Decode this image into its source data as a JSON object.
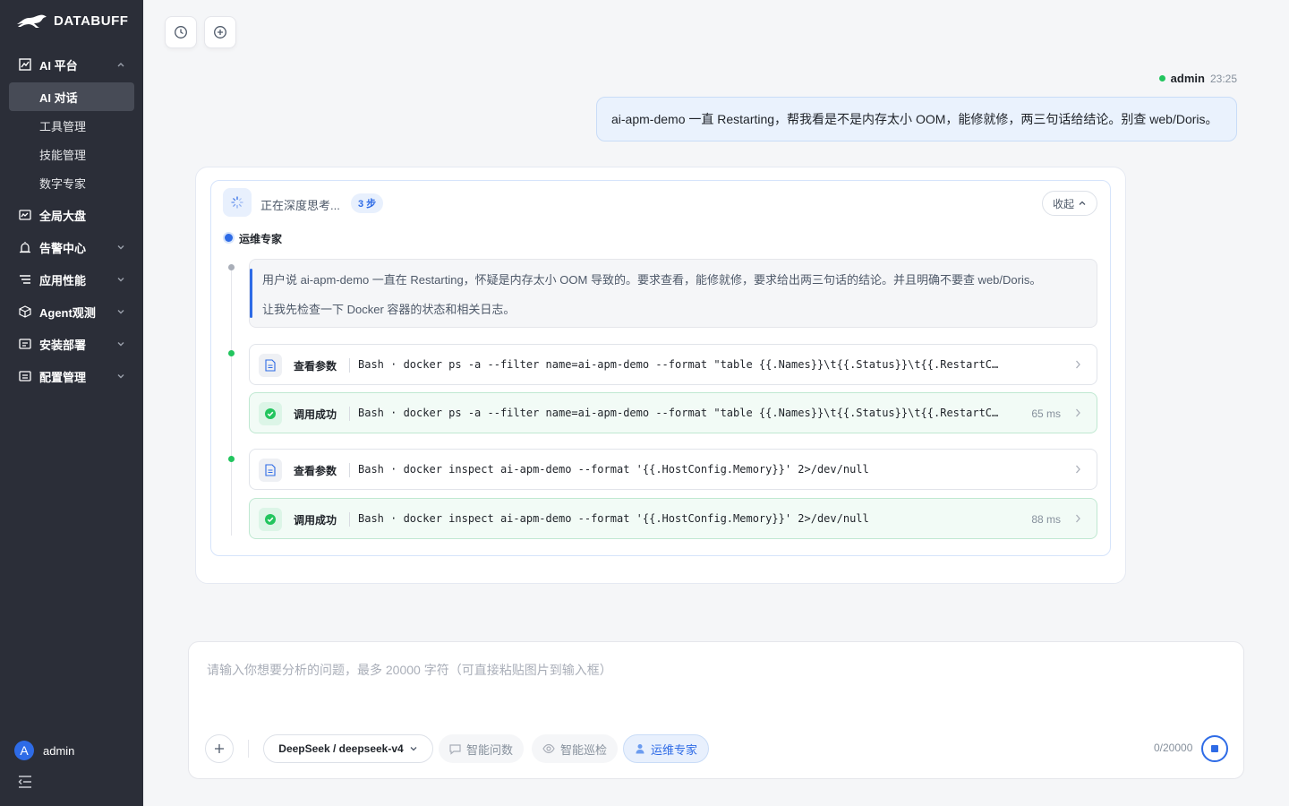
{
  "brand": {
    "name": "DATABUFF"
  },
  "sidebar": {
    "groups": [
      {
        "label": "AI 平台",
        "icon": "ai-chart-icon",
        "expanded": true
      },
      {
        "label": "全局大盘",
        "icon": "dashboard-icon"
      },
      {
        "label": "告警中心",
        "icon": "alarm-icon"
      },
      {
        "label": "应用性能",
        "icon": "list-icon"
      },
      {
        "label": "Agent观测",
        "icon": "cube-icon"
      },
      {
        "label": "安装部署",
        "icon": "install-icon"
      },
      {
        "label": "配置管理",
        "icon": "config-icon"
      }
    ],
    "sub_items": [
      {
        "label": "AI 对话",
        "active": true
      },
      {
        "label": "工具管理"
      },
      {
        "label": "技能管理"
      },
      {
        "label": "数字专家"
      }
    ],
    "user": {
      "avatar_letter": "A",
      "name": "admin"
    }
  },
  "top_actions": {
    "history_icon": "history-icon",
    "new_chat_icon": "plus-circle-icon"
  },
  "message": {
    "user": "admin",
    "time": "23:25",
    "text": "ai-apm-demo 一直 Restarting，帮我看是不是内存太小 OOM，能修就修，两三句话给结论。别查 web/Doris。"
  },
  "response": {
    "thinking_title": "正在深度思考...",
    "steps_badge": "3 步",
    "collapse_label": "收起",
    "agent_name": "运维专家",
    "reasoning": [
      "用户说 ai-apm-demo 一直在 Restarting，怀疑是内存太小 OOM 导致的。要求查看，能修就修，要求给出两三句话的结论。并且明确不要查 web/Doris。",
      "让我先检查一下 Docker 容器的状态和相关日志。"
    ],
    "tool_calls": [
      {
        "kind": "param",
        "label": "查看参数",
        "command": "Bash · docker ps -a --filter name=ai-apm-demo --format \"table {{.Names}}\\t{{.Status}}\\t{{.RestartCount}}\"",
        "duration": ""
      },
      {
        "kind": "ok",
        "label": "调用成功",
        "command": "Bash · docker ps -a --filter name=ai-apm-demo --format \"table {{.Names}}\\t{{.Status}}\\t{{.RestartCount}}\"",
        "duration": "65 ms"
      },
      {
        "kind": "param",
        "label": "查看参数",
        "command": "Bash · docker inspect ai-apm-demo --format '{{.HostConfig.Memory}}' 2>/dev/null",
        "duration": ""
      },
      {
        "kind": "ok",
        "label": "调用成功",
        "command": "Bash · docker inspect ai-apm-demo --format '{{.HostConfig.Memory}}' 2>/dev/null",
        "duration": "88 ms"
      }
    ]
  },
  "composer": {
    "placeholder": "请输入你想要分析的问题，最多 20000 字符（可直接粘贴图片到输入框）",
    "model": "DeepSeek / deepseek-v4",
    "modes": [
      {
        "label": "智能问数",
        "icon": "chat-data-icon"
      },
      {
        "label": "智能巡检",
        "icon": "eye-icon"
      },
      {
        "label": "运维专家",
        "icon": "person-icon",
        "active": true
      }
    ],
    "counter": "0/20000"
  },
  "colors": {
    "accent": "#2e6be6",
    "success": "#22c55e",
    "sidebar_bg": "#2b2e38"
  }
}
